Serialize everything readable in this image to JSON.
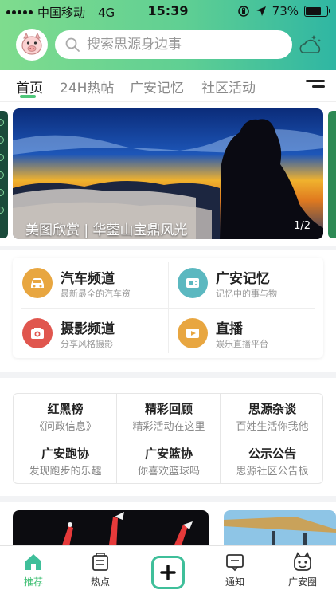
{
  "status_bar": {
    "carrier": "中国移动",
    "network": "4G",
    "time": "15:39",
    "battery": "73%",
    "battery_level": 0.73
  },
  "header": {
    "search_placeholder": "搜索思源身边事"
  },
  "tabs": [
    {
      "label": "首页",
      "active": true
    },
    {
      "label": "24H热帖",
      "active": false
    },
    {
      "label": "广安记忆",
      "active": false
    },
    {
      "label": "社区活动",
      "active": false
    }
  ],
  "banner": {
    "caption": "美图欣赏 | 华蓥山宝鼎风光",
    "page_indicator": "1/2"
  },
  "channels": [
    {
      "title": "汽车频道",
      "subtitle": "最新最全的汽车资",
      "icon": "car-icon",
      "color": "#e8a640"
    },
    {
      "title": "广安记忆",
      "subtitle": "记忆中的事与物",
      "icon": "memory-icon",
      "color": "#5bb8c0"
    },
    {
      "title": "摄影频道",
      "subtitle": "分享风格摄影",
      "icon": "camera-icon",
      "color": "#e0564e"
    },
    {
      "title": "直播",
      "subtitle": "娱乐直播平台",
      "icon": "live-icon",
      "color": "#e8a640"
    }
  ],
  "groups": [
    {
      "title": "红黑榜",
      "subtitle": "《问政信息》"
    },
    {
      "title": "精彩回顾",
      "subtitle": "精彩活动在这里"
    },
    {
      "title": "思源杂谈",
      "subtitle": "百姓生活你我他"
    },
    {
      "title": "广安跑协",
      "subtitle": "发现跑步的乐趣"
    },
    {
      "title": "广安篮协",
      "subtitle": "你喜欢篮球吗"
    },
    {
      "title": "公示公告",
      "subtitle": "思源社区公告板"
    }
  ],
  "bottom_nav": [
    {
      "label": "推荐",
      "icon": "home-icon",
      "active": true
    },
    {
      "label": "热点",
      "icon": "hot-icon",
      "active": false
    },
    {
      "label": "",
      "icon": "plus-icon",
      "active": false
    },
    {
      "label": "通知",
      "icon": "notification-icon",
      "active": false
    },
    {
      "label": "广安圈",
      "icon": "circle-icon",
      "active": false
    }
  ],
  "colors": {
    "accent": "#4fc77a",
    "header_start": "#7fdc8e",
    "header_end": "#2fb6a3"
  }
}
